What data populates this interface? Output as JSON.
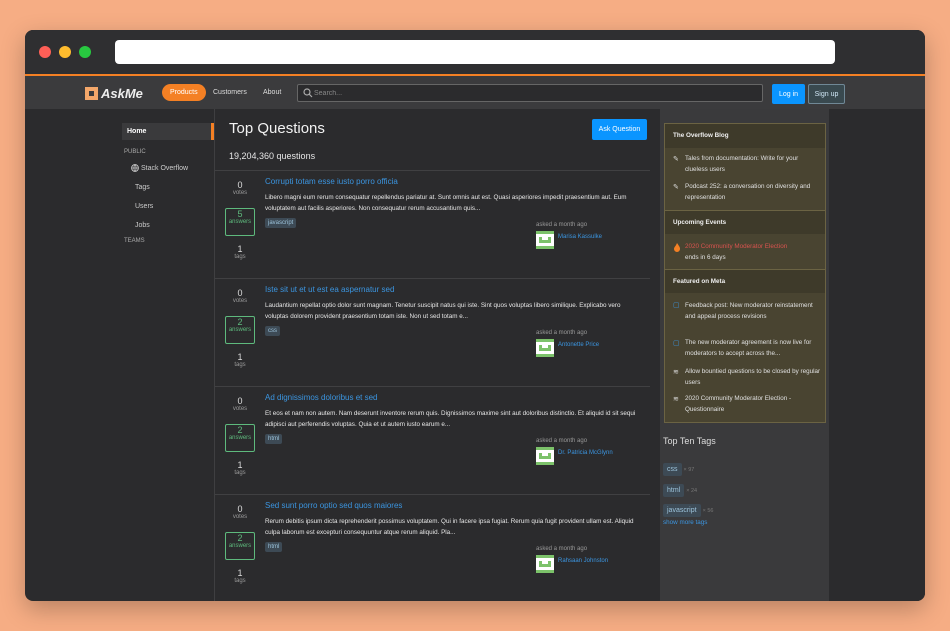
{
  "brand": {
    "name": "AskMe"
  },
  "topnav": {
    "products": "Products",
    "customers": "Customers",
    "about": "About",
    "search_placeholder": "Search...",
    "login": "Log in",
    "signup": "Sign up"
  },
  "sidebar": {
    "home": "Home",
    "public": "PUBLIC",
    "stack_overflow": "Stack Overflow",
    "tags": "Tags",
    "users": "Users",
    "jobs": "Jobs",
    "teams": "TEAMS"
  },
  "main": {
    "title": "Top Questions",
    "ask_button": "Ask Question",
    "question_count": "19,204,360 questions",
    "questions": [
      {
        "votes": "0",
        "votes_label": "votes",
        "answers": "5",
        "answers_label": "answers",
        "tags_count": "1",
        "tags_label": "tags",
        "title": "Corrupti totam esse iusto porro officia",
        "excerpt": "Libero magni eum rerum consequatur repellendus pariatur at. Sunt omnis aut est. Quasi asperiores impedit praesentium aut. Eum voluptatem aut facilis asperiores. Non consequatur rerum accusantium quis...",
        "tag": "javascript",
        "asked": "asked a month ago",
        "user": "Marisa Kassulke"
      },
      {
        "votes": "0",
        "votes_label": "votes",
        "answers": "2",
        "answers_label": "answers",
        "tags_count": "1",
        "tags_label": "tags",
        "title": "Iste sit ut et ut est ea aspernatur sed",
        "excerpt": "Laudantium repellat optio dolor sunt magnam. Tenetur suscipit natus qui iste. Sint quos voluptas libero similique. Explicabo vero voluptas dolorem provident praesentium totam iste. Non ut sed totam e...",
        "tag": "css",
        "asked": "asked a month ago",
        "user": "Antonette Price"
      },
      {
        "votes": "0",
        "votes_label": "votes",
        "answers": "2",
        "answers_label": "answers",
        "tags_count": "1",
        "tags_label": "tags",
        "title": "Ad dignissimos doloribus et sed",
        "excerpt": "Et eos et nam non autem. Nam deserunt inventore rerum quis. Dignissimos maxime sint aut doloribus distinctio. Et aliquid id sit sequi adipisci aut perferendis voluptas. Quia et ut autem iusto earum e...",
        "tag": "html",
        "asked": "asked a month ago",
        "user": "Dr. Patricia McGlynn"
      },
      {
        "votes": "0",
        "votes_label": "votes",
        "answers": "2",
        "answers_label": "answers",
        "tags_count": "1",
        "tags_label": "tags",
        "title": "Sed sunt porro optio sed quos maiores",
        "excerpt": "Rerum debitis ipsum dicta reprehenderit possimus voluptatem. Qui in facere ipsa fugiat. Rerum quia fugit provident ullam est. Aliquid culpa laborum est excepturi consequuntur atque rerum aliquid. Pla...",
        "tag": "html",
        "asked": "asked a month ago",
        "user": "Rahsaan Johnston"
      }
    ]
  },
  "blog": {
    "header": "The Overflow Blog",
    "items": [
      "Tales from documentation: Write for your clueless users",
      "Podcast 252: a conversation on diversity and representation"
    ],
    "events_header": "Upcoming Events",
    "event": "2020 Community Moderator Election",
    "event_sub": "ends in 6 days",
    "meta_header": "Featured on Meta",
    "meta_items": [
      "Feedback post: New moderator reinstatement and appeal process revisions",
      "The new moderator agreement is now live for moderators to accept across the...",
      "Allow bountied questions to be closed by regular users",
      "2020 Community Moderator Election - Questionnaire"
    ]
  },
  "top_tags": {
    "header": "Top Ten Tags",
    "tags": [
      {
        "name": "css",
        "count": "× 97"
      },
      {
        "name": "html",
        "count": "× 24"
      },
      {
        "name": "javascript",
        "count": "× 56"
      }
    ],
    "more": "show more tags"
  },
  "colors": {
    "accent": "#f48024",
    "link": "#3b95e0",
    "answered": "#5eba7d",
    "background": "#2b2b2d"
  }
}
